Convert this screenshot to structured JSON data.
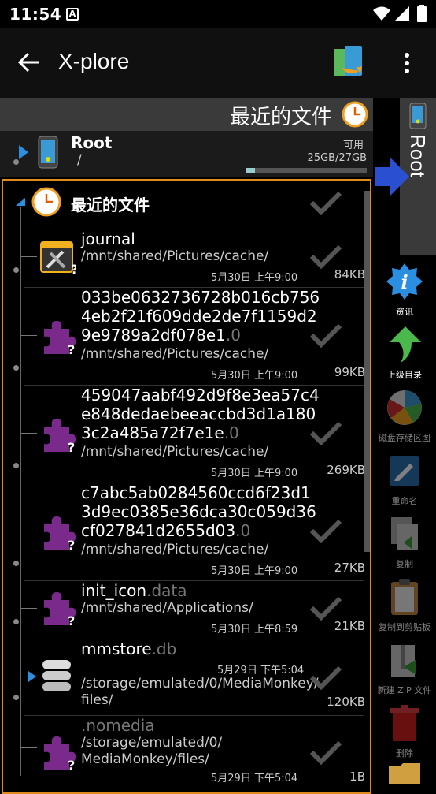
{
  "status": {
    "time": "11:54"
  },
  "header": {
    "title": "X-plore"
  },
  "tabs": {
    "current": "最近的文件"
  },
  "root": {
    "name": "Root",
    "path": "/",
    "available_label": "可用",
    "space": "25GB/27GB",
    "used_fraction": 0.08,
    "side_label": "Root"
  },
  "recent": {
    "title": "最近的文件"
  },
  "files": [
    {
      "name": "journal",
      "ext": "",
      "path": "/mnt/shared/Pictures/cache/",
      "date": "5月30日 上午9:00",
      "size": "84KB",
      "icon": "tools-icon"
    },
    {
      "name": "033be0632736728b016cb756\n4eb2f21f609dde2de7f1159d2\n9e9789a2df078e1",
      "ext": ".0",
      "path": "/mnt/shared/Pictures/cache/",
      "date": "5月30日 上午9:00",
      "size": "99KB",
      "icon": "puzzle-icon"
    },
    {
      "name": "459047aabf492d9f8e3ea57c4\ne848dedaebeeaccbd3d1a180\n3c2a485a72f7e1e",
      "ext": ".0",
      "path": "/mnt/shared/Pictures/cache/",
      "date": "5月30日 上午9:00",
      "size": "269KB",
      "icon": "puzzle-icon"
    },
    {
      "name": "c7abc5ab0284560ccd6f23d1\n3d9ec0385e36dca30c059d36\ncf027841d2655d03",
      "ext": ".0",
      "path": "/mnt/shared/Pictures/cache/",
      "date": "5月30日 上午9:00",
      "size": "27KB",
      "icon": "puzzle-icon"
    },
    {
      "name": "init_icon",
      "ext": ".data",
      "path": "/mnt/shared/Applications/",
      "date": "5月30日 上午8:59",
      "size": "21KB",
      "icon": "puzzle-icon"
    },
    {
      "name": "mmstore",
      "ext": ".db",
      "path": "/storage/emulated/0/MediaMonkey/\nfiles/",
      "date": "5月29日 下午5:04",
      "size": "120KB",
      "icon": "database-icon"
    },
    {
      "name": "",
      "ext": ".nomedia",
      "path": "/storage/emulated/0/\nMediaMonkey/files/",
      "date": "5月29日 下午5:04",
      "size": "1B",
      "icon": "puzzle-icon"
    }
  ],
  "toolbar": [
    {
      "label": "资讯",
      "icon": "info-icon",
      "color": "#2a7bd6"
    },
    {
      "label": "上级目录",
      "icon": "up-arrow-icon",
      "color": "#3aa63a"
    },
    {
      "label": "磁盘存储区图",
      "icon": "pie-chart-icon",
      "color": "#888"
    },
    {
      "label": "重命名",
      "icon": "rename-icon",
      "color": "#2a6fb0"
    },
    {
      "label": "复制",
      "icon": "copy-icon",
      "color": "#3a6a9a"
    },
    {
      "label": "复制到剪贴板",
      "icon": "clipboard-icon",
      "color": "#a07a40"
    },
    {
      "label": "新建 ZIP 文件",
      "icon": "zip-icon",
      "color": "#3a7a3a"
    },
    {
      "label": "删除",
      "icon": "trash-icon",
      "color": "#b02020"
    }
  ]
}
